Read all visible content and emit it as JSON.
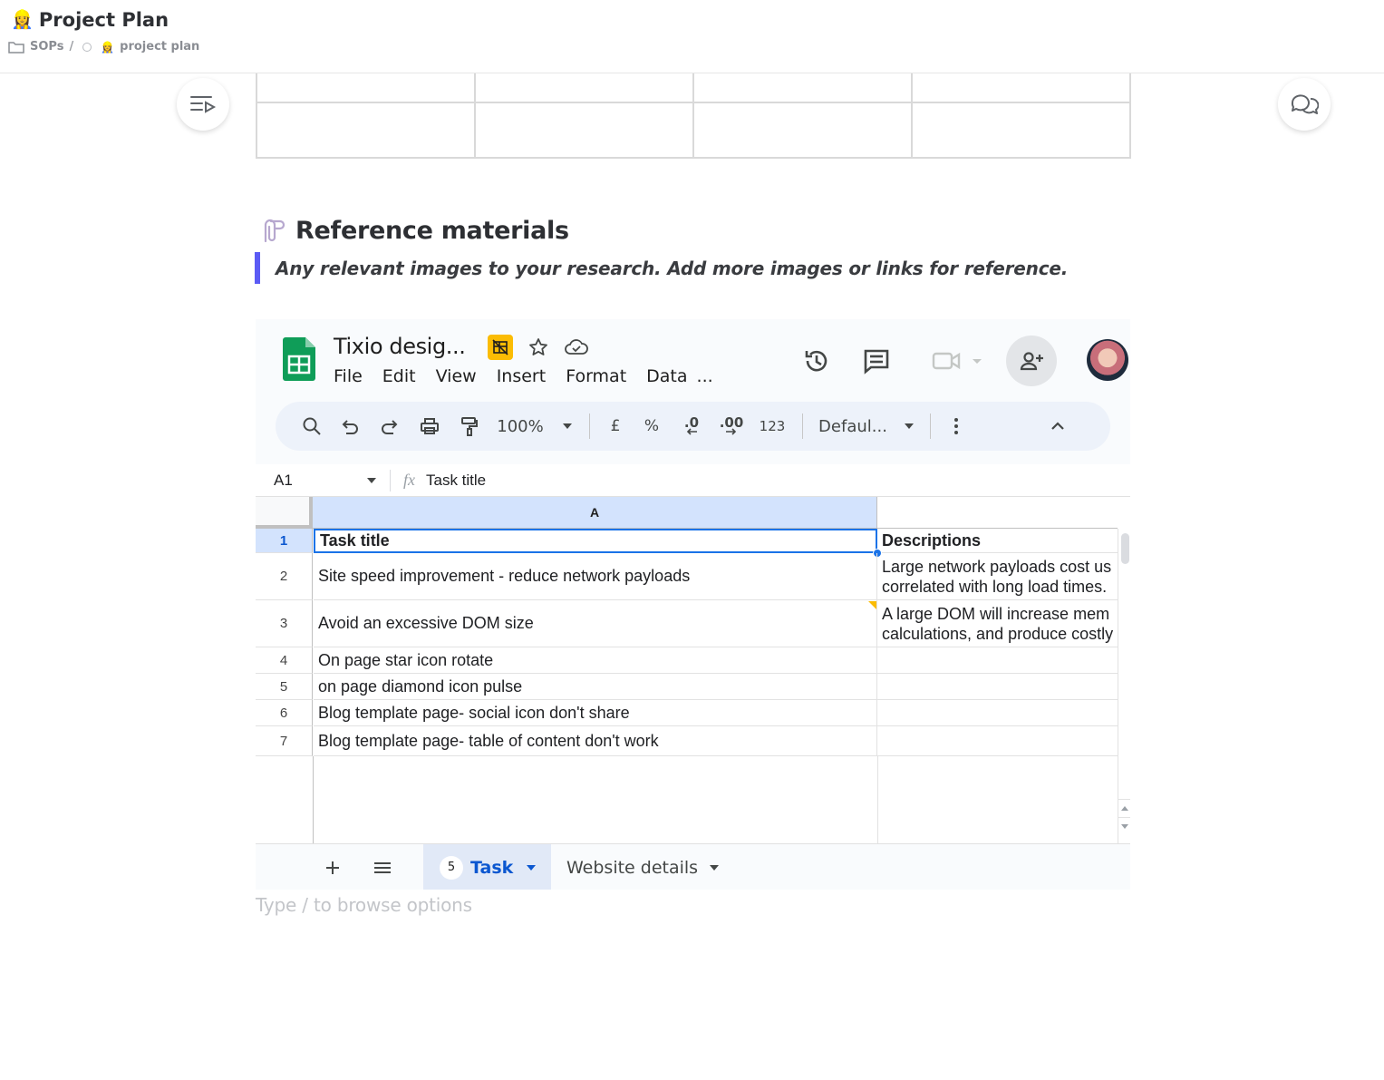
{
  "header": {
    "title_emoji": "👷‍♀️",
    "title": "Project Plan",
    "breadcrumb": {
      "folder": "SOPs",
      "separator": "/",
      "page_emoji": "👷‍♀️",
      "page": "project plan"
    }
  },
  "section": {
    "title": "Reference materials",
    "callout": "Any relevant images to your research. Add more images or links for reference."
  },
  "sheet": {
    "doc_title": "Tixio desig...",
    "menu": [
      "File",
      "Edit",
      "View",
      "Insert",
      "Format",
      "Data",
      "..."
    ],
    "toolbar": {
      "zoom": "100%",
      "currency": "£",
      "percent": "%",
      "dec_decrease": ".0",
      "dec_increase": ".00",
      "number_format": "123",
      "font": "Defaul..."
    },
    "formula": {
      "cell_ref": "A1",
      "fx": "fx",
      "value": "Task title"
    },
    "columns": [
      "A",
      ""
    ],
    "rows": [
      {
        "num": "1",
        "a": "Task title",
        "b": [
          "Descriptions"
        ]
      },
      {
        "num": "2",
        "a": "Site speed improvement - reduce network payloads",
        "b": [
          "Large network payloads cost us",
          "correlated with long load times."
        ]
      },
      {
        "num": "3",
        "a": "Avoid an excessive DOM size",
        "b": [
          "A large DOM will increase mem",
          "calculations, and produce costly"
        ]
      },
      {
        "num": "4",
        "a": "On page star icon rotate",
        "b": [
          ""
        ]
      },
      {
        "num": "5",
        "a": "on page diamond icon pulse",
        "b": [
          ""
        ]
      },
      {
        "num": "6",
        "a": "Blog template page- social icon don't share",
        "b": [
          ""
        ]
      },
      {
        "num": "7",
        "a": "Blog template page- table of content don't work",
        "b": [
          ""
        ]
      }
    ],
    "tabs": {
      "active_count": "5",
      "active": "Task",
      "other": "Website details"
    }
  },
  "editor": {
    "placeholder": "Type / to browse options"
  },
  "colors": {
    "accent_quote": "#5b5bf5",
    "sheets_green": "#0f9d58",
    "selection_blue": "#1a73e8",
    "tab_active": "#0b57d0"
  }
}
